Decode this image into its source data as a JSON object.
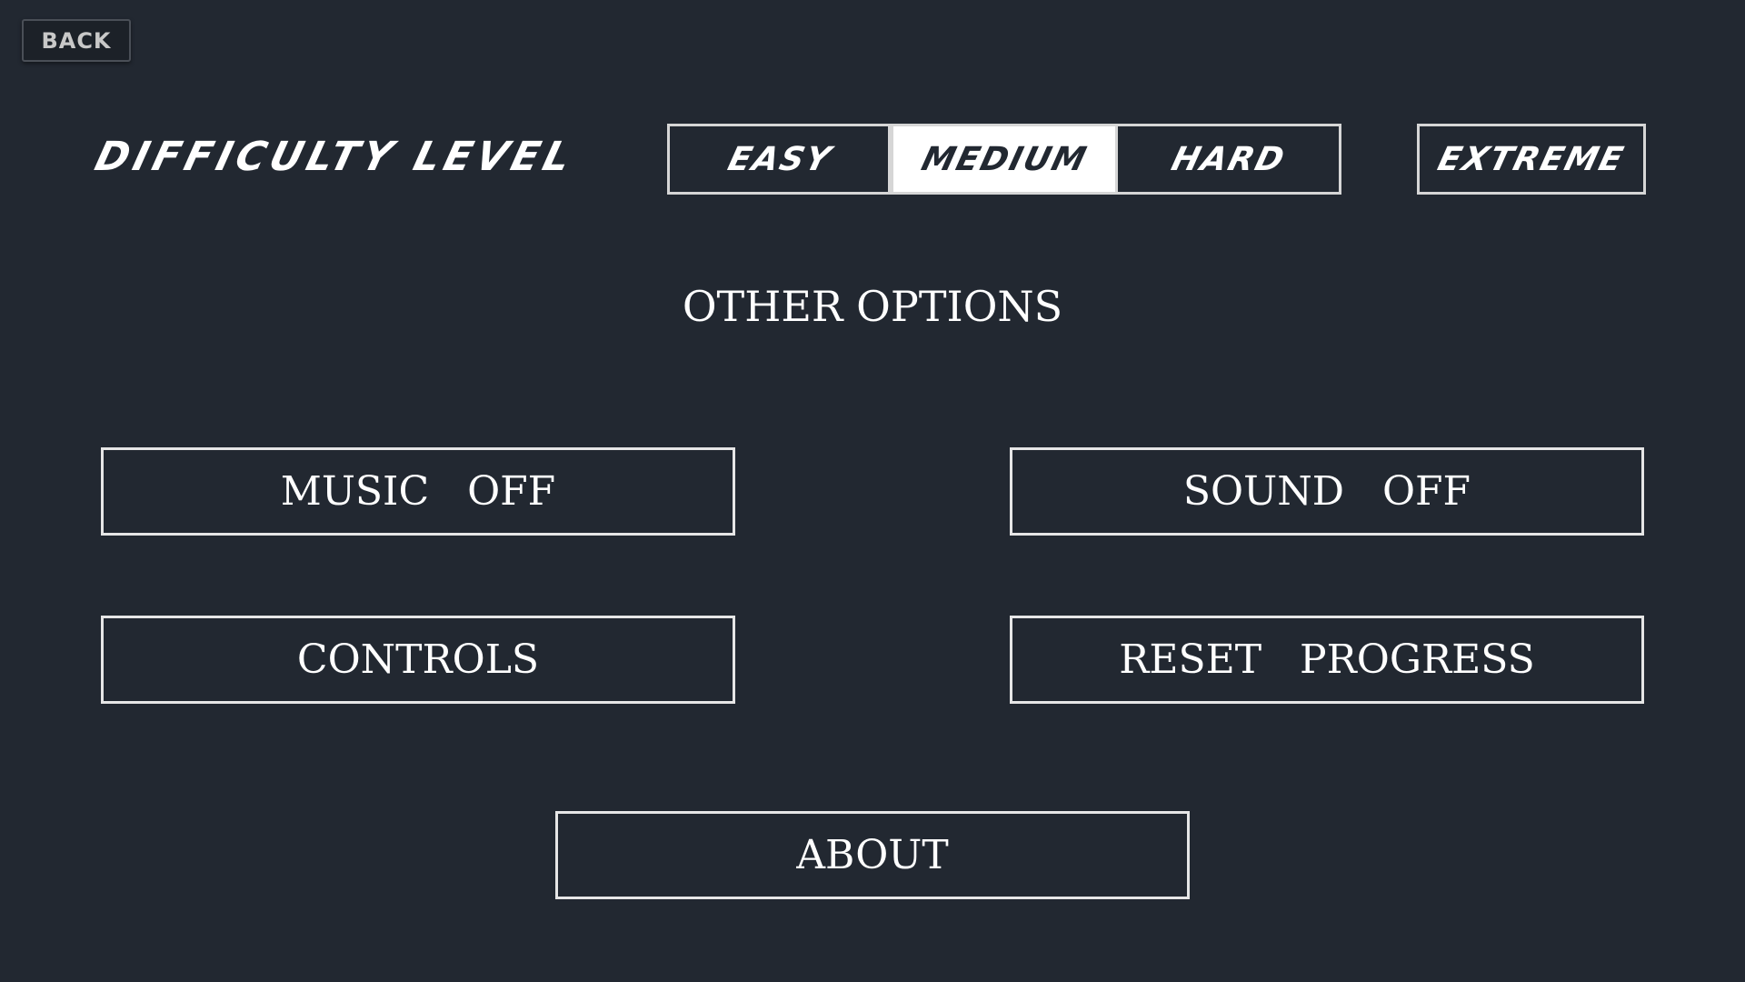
{
  "header": {
    "back_label": "BACK"
  },
  "difficulty": {
    "label": "DIFFICULTY LEVEL",
    "options": [
      {
        "label": "EASY",
        "selected": false
      },
      {
        "label": "MEDIUM",
        "selected": true
      },
      {
        "label": "HARD",
        "selected": false
      }
    ],
    "extreme_label": "EXTREME"
  },
  "other": {
    "title": "OTHER OPTIONS",
    "music_label": "MUSIC   OFF",
    "sound_label": "SOUND   OFF",
    "controls_label": "CONTROLS",
    "reset_label": "RESET   PROGRESS",
    "about_label": "ABOUT"
  },
  "colors": {
    "background": "#222831",
    "foreground": "#ffffff",
    "selected_background": "#ffffff",
    "selected_foreground": "#222831"
  }
}
